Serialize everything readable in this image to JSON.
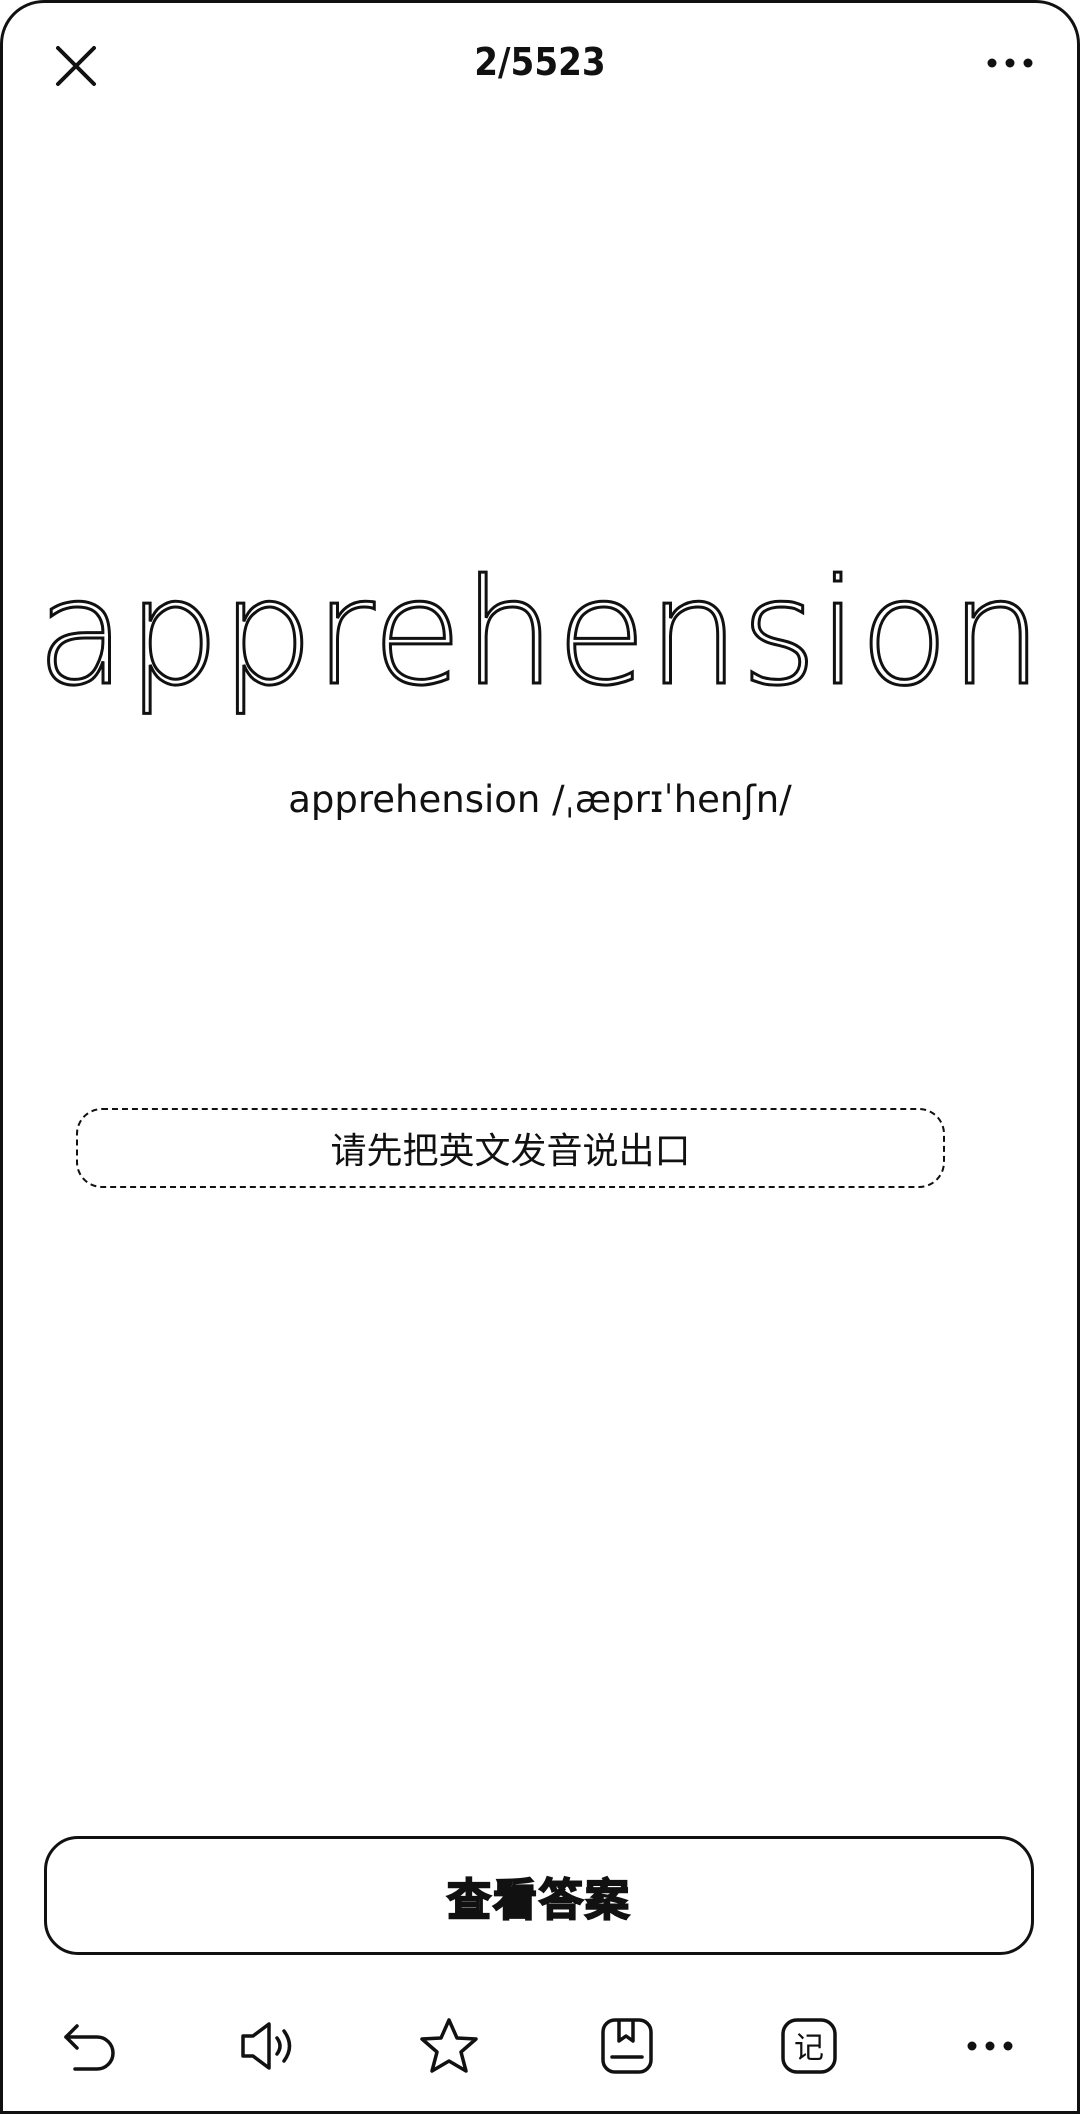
{
  "header": {
    "close_icon": "close-icon",
    "counter": "2/5523",
    "more_icon": "more-horizontal-icon"
  },
  "card": {
    "word": "apprehension",
    "phonetic": "apprehension /ˌæprɪˈhenʃn/",
    "prompt": "请先把英文发音说出口"
  },
  "actions": {
    "show_answer_label": "查看答案"
  },
  "toolbar": {
    "items": [
      {
        "icon": "undo-icon"
      },
      {
        "icon": "speaker-icon"
      },
      {
        "icon": "star-icon"
      },
      {
        "icon": "bookmark-book-icon"
      },
      {
        "icon": "note-icon",
        "glyph": "记"
      },
      {
        "icon": "more-horizontal-icon"
      }
    ]
  },
  "colors": {
    "foreground": "#111111",
    "background": "#ffffff"
  }
}
